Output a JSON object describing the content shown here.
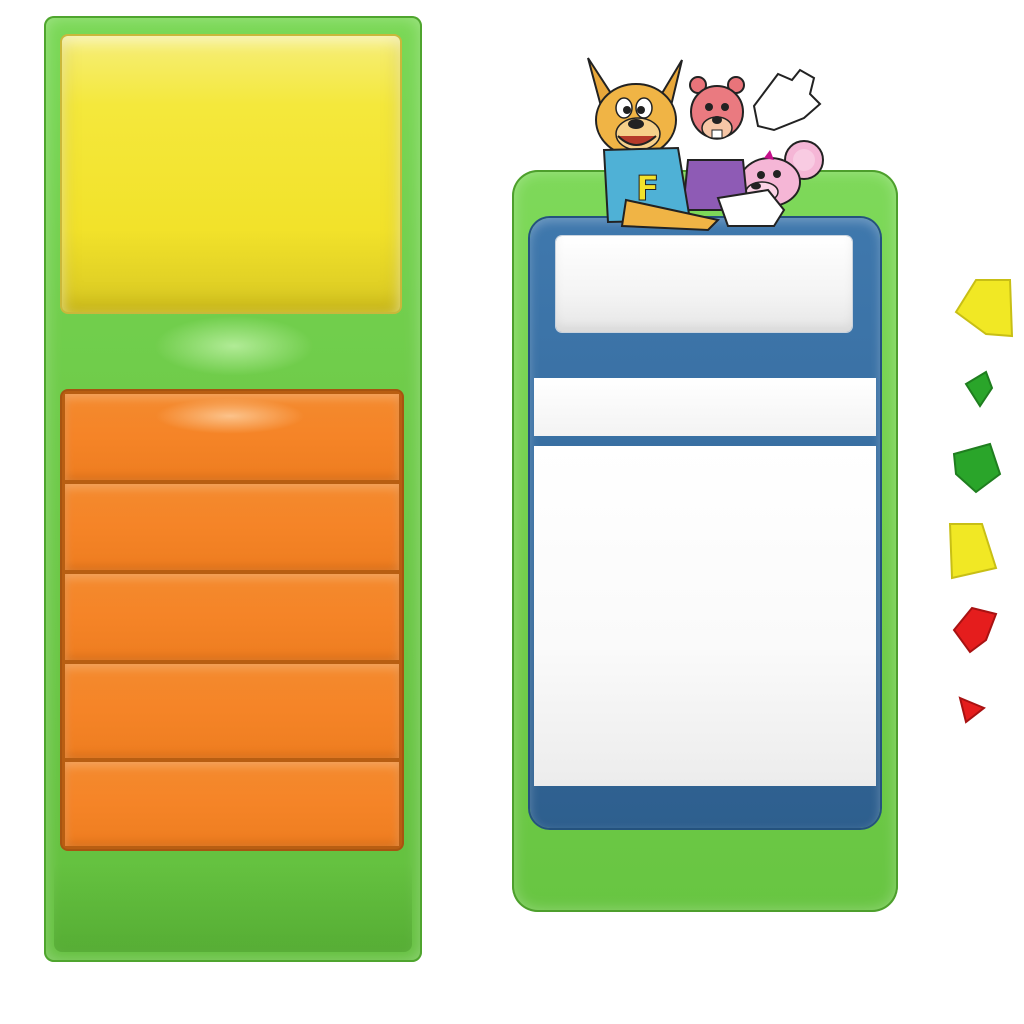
{
  "colors": {
    "panel_green": "#72d04b",
    "yellow_box": "#f2e22a",
    "orange_row": "#f58427",
    "dialog_blue": "#356a9c",
    "field_white": "#ffffff"
  },
  "left_panel": {
    "orange_rows": [
      {
        "label": ""
      },
      {
        "label": ""
      },
      {
        "label": ""
      },
      {
        "label": ""
      },
      {
        "label": ""
      }
    ]
  },
  "right_panel": {
    "title_text": "",
    "header_text": "",
    "content_text": ""
  },
  "mascots": {
    "icons": [
      "kangaroo-mascot-icon",
      "squirrel-mascot-icon",
      "mouse-mascot-icon"
    ]
  },
  "gems": [
    {
      "icon": "yellow-gem-large-icon",
      "color": "#f1e824"
    },
    {
      "icon": "green-gem-small-icon",
      "color": "#2aa52a"
    },
    {
      "icon": "green-gem-medium-icon",
      "color": "#2aa52a"
    },
    {
      "icon": "yellow-gem-medium-icon",
      "color": "#f1e824"
    },
    {
      "icon": "red-gem-medium-icon",
      "color": "#e51d1d"
    },
    {
      "icon": "red-gem-small-icon",
      "color": "#e51d1d"
    }
  ]
}
